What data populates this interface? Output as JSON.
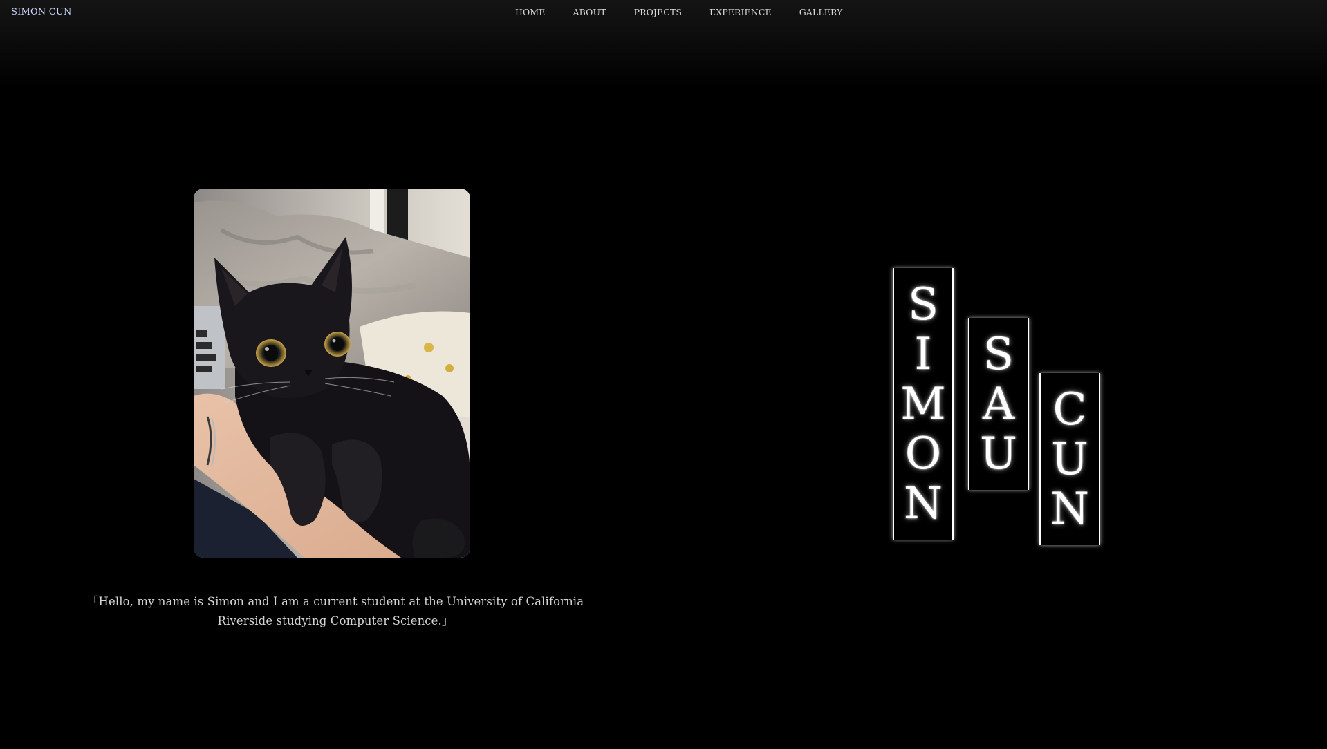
{
  "header": {
    "brand": "SIMON CUN",
    "nav": {
      "home": "HOME",
      "about": "ABOUT",
      "projects": "PROJECTS",
      "experience": "EXPERIENCE",
      "gallery": "GALLERY"
    }
  },
  "hero": {
    "photo_subject": "black-cat-photo",
    "intro": "「Hello, my name is Simon and I am a current student at the University of California Riverside studying Computer Science.」"
  },
  "name_columns": [
    {
      "letters": [
        "S",
        "I",
        "M",
        "O",
        "N"
      ]
    },
    {
      "letters": [
        "S",
        "A",
        "U"
      ]
    },
    {
      "letters": [
        "C",
        "U",
        "N"
      ]
    }
  ],
  "colors": {
    "background": "#000000",
    "brand": "#cfd8ff",
    "nav_text": "#d9d9d9",
    "intro_text": "#d4d4d4",
    "glow": "#ffffff"
  }
}
